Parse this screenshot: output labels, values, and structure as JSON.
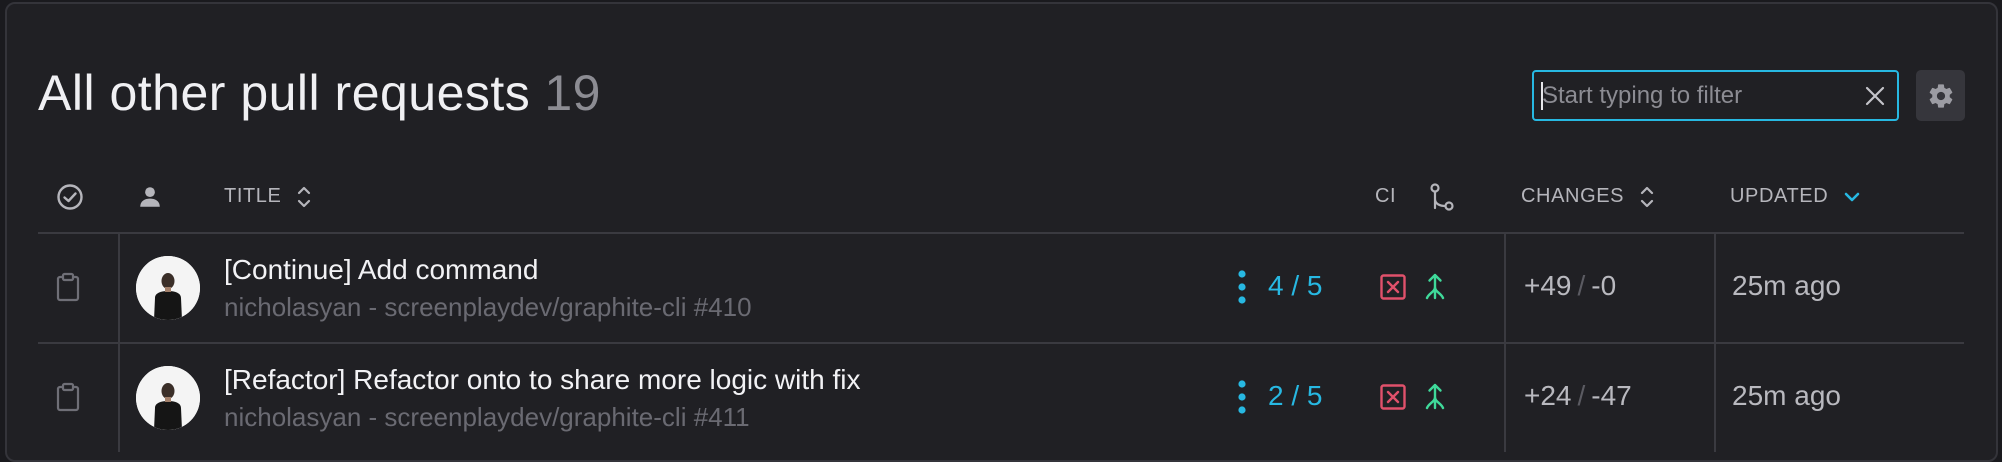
{
  "header": {
    "title": "All other pull requests",
    "count": "19"
  },
  "filter": {
    "placeholder": "Start typing to filter",
    "value": ""
  },
  "columns": {
    "title": "TITLE",
    "ci": "CI",
    "changes": "CHANGES",
    "updated": "UPDATED"
  },
  "icons": {
    "status": "check-circle-icon",
    "author": "person-icon",
    "title_sort": "sort-icon",
    "ci_branch": "git-branch-icon",
    "changes_sort": "sort-icon",
    "updated_sort": "chevron-down-icon",
    "settings": "gear-icon",
    "clear": "close-icon"
  },
  "colors": {
    "accent": "#27b8e2",
    "ci_fail": "#e0516b",
    "merge": "#3fd99a"
  },
  "rows": [
    {
      "title": "[Continue] Add command",
      "subtitle": "nicholasyan - screenplaydev/graphite-cli #410",
      "reviews": "4 / 5",
      "additions": "+49",
      "separator": "/",
      "deletions": "-0",
      "updated": "25m ago"
    },
    {
      "title": "[Refactor] Refactor onto to share more logic with fix",
      "subtitle": "nicholasyan - screenplaydev/graphite-cli #411",
      "reviews": "2 / 5",
      "additions": "+24",
      "separator": "/",
      "deletions": "-47",
      "updated": "25m ago"
    }
  ]
}
